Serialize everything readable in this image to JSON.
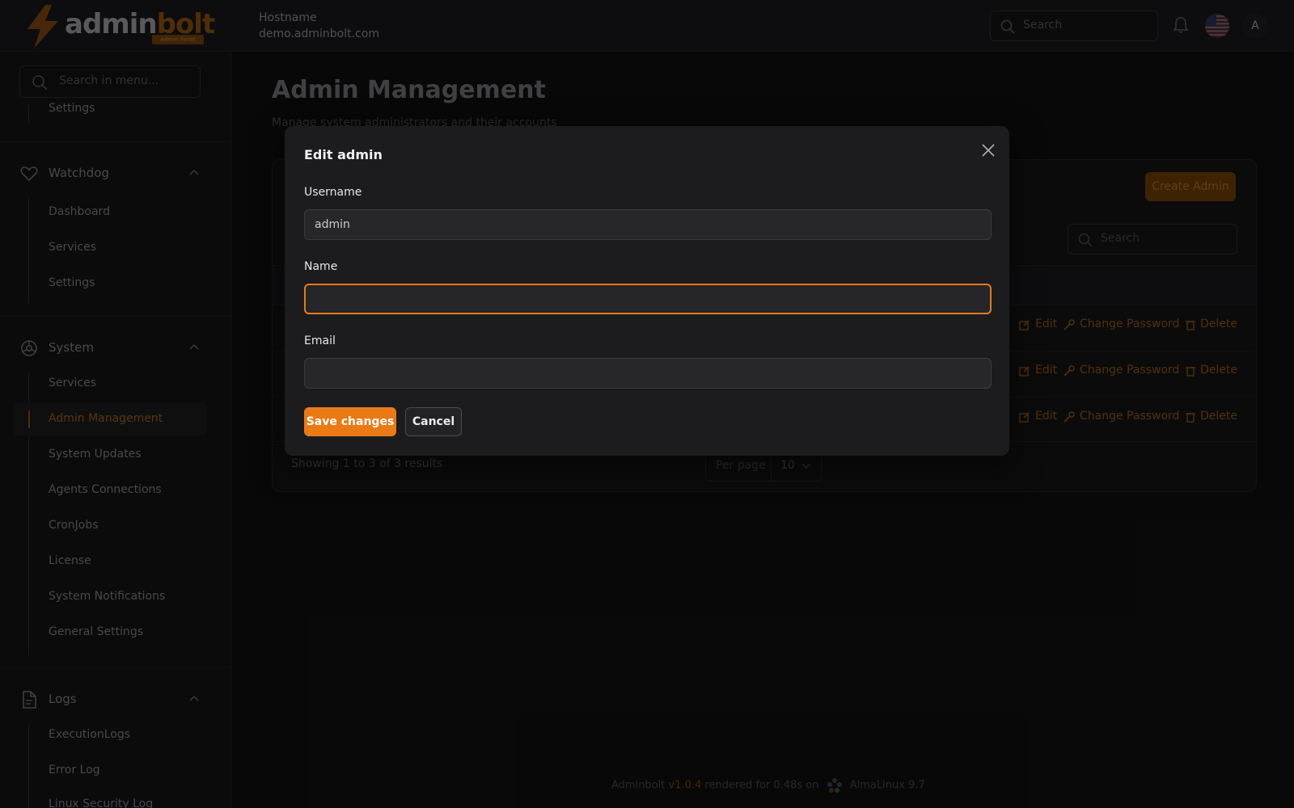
{
  "brand": {
    "name_part1": "admin",
    "name_part2": "bolt",
    "tagline": "Admin Panel"
  },
  "header": {
    "host_label": "Hostname",
    "host_value": "demo.adminbolt.com",
    "search_placeholder": "Search",
    "avatar_letter": "A"
  },
  "sidebar": {
    "search_placeholder": "Search in menu...",
    "top_cut_item": "Settings",
    "groups": [
      {
        "label": "Watchdog",
        "icon": "heart-icon",
        "items": [
          "Dashboard",
          "Services",
          "Settings"
        ]
      },
      {
        "label": "System",
        "icon": "gear-icon",
        "items": [
          "Services",
          "Admin Management",
          "System Updates",
          "Agents Connections",
          "CronJobs",
          "License",
          "System Notifications",
          "General Settings"
        ]
      },
      {
        "label": "Logs",
        "icon": "document-icon",
        "items": [
          "ExecutionLogs",
          "Error Log",
          "Linux Security Log"
        ]
      }
    ],
    "active_item": "Admin Management"
  },
  "main": {
    "title": "Admin Management",
    "subtitle": "Manage system administrators and their accounts",
    "create_button": "Create Admin",
    "table_search_placeholder": "Search",
    "row_actions": {
      "edit": "Edit",
      "change_password": "Change Password",
      "delete": "Delete"
    },
    "results_text": "Showing 1 to 3 of 3 results",
    "per_page_label": "Per page",
    "per_page_value": "10"
  },
  "footer": {
    "app": "Adminbolt",
    "version": "v1.0.4",
    "rendered": "rendered for 0.48s on",
    "os": "AlmaLinux 9.7"
  },
  "modal": {
    "title": "Edit admin",
    "username_label": "Username",
    "username_value": "admin",
    "name_label": "Name",
    "name_value": "",
    "email_label": "Email",
    "email_value": "",
    "save_label": "Save changes",
    "cancel_label": "Cancel"
  },
  "colors": {
    "accent": "#ea7a16",
    "focus_ring": "#e5791a",
    "background": "#0f0f10"
  }
}
